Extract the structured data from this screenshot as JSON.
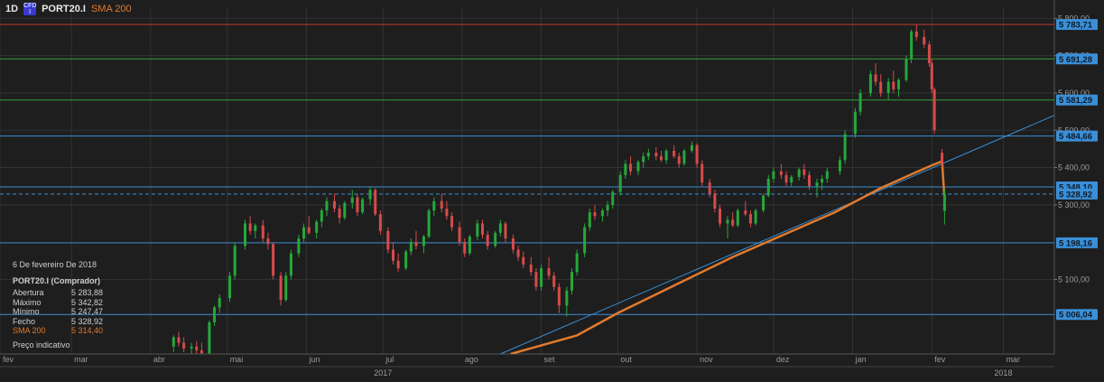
{
  "header": {
    "timeframe": "1D",
    "badge_top": "CFD",
    "badge_bottom": "I",
    "symbol": "PORT20.I",
    "indicator": "SMA 200"
  },
  "info": {
    "date": "6 De fevereiro De 2018",
    "title": "PORT20.I (Comprador)",
    "rows": [
      {
        "label": "Abertura",
        "value": "5 283,88"
      },
      {
        "label": "Máximo",
        "value": "5 342,82"
      },
      {
        "label": "Mínimo",
        "value": "5 247,47"
      },
      {
        "label": "Fecho",
        "value": "5 328,92"
      }
    ],
    "sma_label": "SMA 200",
    "sma_value": "5 314,40",
    "note": "Preço indicativo"
  },
  "chart_data": {
    "type": "candlestick",
    "y_range": [
      4900,
      5830
    ],
    "y_ticks": [
      {
        "v": 5800,
        "label": "5 800,00"
      },
      {
        "v": 5700,
        "label": "5 700,00"
      },
      {
        "v": 5600,
        "label": "5 600,00"
      },
      {
        "v": 5500,
        "label": "5 500,00"
      },
      {
        "v": 5400,
        "label": "5 400,00"
      },
      {
        "v": 5300,
        "label": "5 300,00"
      },
      {
        "v": 5100,
        "label": "5 100,00"
      }
    ],
    "x_range": [
      "2017-02-01",
      "2018-03-21"
    ],
    "x_months": [
      {
        "d": "2017-02-01",
        "label": "fev"
      },
      {
        "d": "2017-03-01",
        "label": "mar"
      },
      {
        "d": "2017-04-01",
        "label": "abr"
      },
      {
        "d": "2017-05-01",
        "label": "mai"
      },
      {
        "d": "2017-06-01",
        "label": "jun"
      },
      {
        "d": "2017-07-01",
        "label": "jul"
      },
      {
        "d": "2017-08-01",
        "label": "ago"
      },
      {
        "d": "2017-09-01",
        "label": "set"
      },
      {
        "d": "2017-10-01",
        "label": "out"
      },
      {
        "d": "2017-11-01",
        "label": "nov"
      },
      {
        "d": "2017-12-01",
        "label": "dez"
      },
      {
        "d": "2018-01-01",
        "label": "jan"
      },
      {
        "d": "2018-02-01",
        "label": "fev"
      },
      {
        "d": "2018-03-01",
        "label": "mar"
      }
    ],
    "x_years": [
      {
        "d": "2017-07-01",
        "label": "2017"
      },
      {
        "d": "2018-03-01",
        "label": "2018"
      }
    ],
    "levels": [
      {
        "v": 5783.71,
        "label": "5 783,71",
        "color": "#c0392b"
      },
      {
        "v": 5691.28,
        "label": "5 691,28",
        "color": "#2e9e3e"
      },
      {
        "v": 5581.29,
        "label": "5 581,29",
        "color": "#2e9e3e"
      },
      {
        "v": 5484.66,
        "label": "5 484,66",
        "color": "#3a8fd6"
      },
      {
        "v": 5348.1,
        "label": "5 348,10",
        "color": "#3a8fd6"
      },
      {
        "v": 5328.92,
        "label": "5 328,92",
        "color": "#3a8fd6",
        "dashed": true
      },
      {
        "v": 5198.16,
        "label": "5 198,16",
        "color": "#3a8fd6"
      },
      {
        "v": 5006.04,
        "label": "5 006,04",
        "color": "#3a8fd6"
      }
    ],
    "trendline": {
      "from": [
        "2017-08-16",
        4900
      ],
      "to": [
        "2018-03-21",
        5540
      ],
      "color": "#3a8fd6"
    },
    "sma200": {
      "color": "#e07a2e",
      "points": [
        [
          "2017-08-20",
          4900
        ],
        [
          "2017-09-15",
          4950
        ],
        [
          "2017-10-01",
          5010
        ],
        [
          "2017-10-25",
          5090
        ],
        [
          "2017-11-15",
          5160
        ],
        [
          "2017-12-05",
          5220
        ],
        [
          "2017-12-25",
          5280
        ],
        [
          "2018-01-12",
          5345
        ],
        [
          "2018-01-30",
          5400
        ],
        [
          "2018-02-05",
          5417
        ],
        [
          "2018-02-06",
          5314.4
        ]
      ]
    },
    "candles": [
      [
        "2017-04-10",
        4920,
        4950,
        4905,
        4945
      ],
      [
        "2017-04-12",
        4945,
        4960,
        4920,
        4930
      ],
      [
        "2017-04-14",
        4930,
        4945,
        4905,
        4915
      ],
      [
        "2017-04-17",
        4915,
        4930,
        4898,
        4920
      ],
      [
        "2017-04-19",
        4920,
        4935,
        4900,
        4910
      ],
      [
        "2017-04-21",
        4910,
        4930,
        4895,
        4902
      ],
      [
        "2017-04-24",
        4902,
        4990,
        4900,
        4985
      ],
      [
        "2017-04-26",
        4985,
        5030,
        4975,
        5025
      ],
      [
        "2017-04-28",
        5025,
        5060,
        5010,
        5050
      ],
      [
        "2017-05-02",
        5050,
        5120,
        5040,
        5110
      ],
      [
        "2017-05-04",
        5110,
        5200,
        5100,
        5190
      ],
      [
        "2017-05-08",
        5190,
        5260,
        5180,
        5250
      ],
      [
        "2017-05-10",
        5250,
        5270,
        5220,
        5230
      ],
      [
        "2017-05-12",
        5230,
        5250,
        5210,
        5245
      ],
      [
        "2017-05-15",
        5245,
        5260,
        5200,
        5210
      ],
      [
        "2017-05-17",
        5210,
        5225,
        5180,
        5195
      ],
      [
        "2017-05-19",
        5195,
        5200,
        5100,
        5110
      ],
      [
        "2017-05-22",
        5110,
        5120,
        5030,
        5045
      ],
      [
        "2017-05-24",
        5045,
        5120,
        5040,
        5110
      ],
      [
        "2017-05-26",
        5110,
        5180,
        5100,
        5170
      ],
      [
        "2017-05-29",
        5170,
        5220,
        5160,
        5210
      ],
      [
        "2017-05-31",
        5210,
        5250,
        5200,
        5240
      ],
      [
        "2017-06-02",
        5240,
        5270,
        5220,
        5225
      ],
      [
        "2017-06-05",
        5225,
        5260,
        5210,
        5255
      ],
      [
        "2017-06-07",
        5255,
        5290,
        5240,
        5285
      ],
      [
        "2017-06-09",
        5285,
        5320,
        5270,
        5310
      ],
      [
        "2017-06-12",
        5310,
        5330,
        5280,
        5290
      ],
      [
        "2017-06-14",
        5290,
        5300,
        5250,
        5265
      ],
      [
        "2017-06-16",
        5265,
        5310,
        5260,
        5305
      ],
      [
        "2017-06-19",
        5305,
        5340,
        5290,
        5320
      ],
      [
        "2017-06-21",
        5320,
        5330,
        5270,
        5280
      ],
      [
        "2017-06-23",
        5280,
        5320,
        5275,
        5315
      ],
      [
        "2017-06-26",
        5315,
        5350,
        5300,
        5340
      ],
      [
        "2017-06-28",
        5340,
        5345,
        5270,
        5275
      ],
      [
        "2017-06-30",
        5275,
        5285,
        5220,
        5230
      ],
      [
        "2017-07-03",
        5230,
        5240,
        5170,
        5180
      ],
      [
        "2017-07-05",
        5180,
        5200,
        5140,
        5150
      ],
      [
        "2017-07-07",
        5150,
        5170,
        5120,
        5130
      ],
      [
        "2017-07-10",
        5130,
        5180,
        5125,
        5175
      ],
      [
        "2017-07-12",
        5175,
        5210,
        5165,
        5200
      ],
      [
        "2017-07-14",
        5200,
        5230,
        5180,
        5190
      ],
      [
        "2017-07-17",
        5190,
        5220,
        5170,
        5215
      ],
      [
        "2017-07-19",
        5215,
        5290,
        5210,
        5285
      ],
      [
        "2017-07-21",
        5285,
        5320,
        5270,
        5310
      ],
      [
        "2017-07-24",
        5310,
        5330,
        5280,
        5290
      ],
      [
        "2017-07-26",
        5290,
        5310,
        5260,
        5270
      ],
      [
        "2017-07-28",
        5270,
        5280,
        5230,
        5240
      ],
      [
        "2017-07-31",
        5240,
        5255,
        5190,
        5200
      ],
      [
        "2017-08-02",
        5200,
        5210,
        5160,
        5170
      ],
      [
        "2017-08-04",
        5170,
        5220,
        5165,
        5215
      ],
      [
        "2017-08-07",
        5215,
        5260,
        5205,
        5250
      ],
      [
        "2017-08-09",
        5250,
        5260,
        5210,
        5220
      ],
      [
        "2017-08-11",
        5220,
        5230,
        5180,
        5190
      ],
      [
        "2017-08-14",
        5190,
        5230,
        5185,
        5225
      ],
      [
        "2017-08-16",
        5225,
        5260,
        5215,
        5250
      ],
      [
        "2017-08-18",
        5250,
        5255,
        5200,
        5210
      ],
      [
        "2017-08-21",
        5210,
        5220,
        5170,
        5180
      ],
      [
        "2017-08-23",
        5180,
        5190,
        5150,
        5160
      ],
      [
        "2017-08-25",
        5160,
        5175,
        5130,
        5140
      ],
      [
        "2017-08-28",
        5140,
        5160,
        5110,
        5120
      ],
      [
        "2017-08-30",
        5120,
        5130,
        5070,
        5080
      ],
      [
        "2017-09-01",
        5080,
        5140,
        5070,
        5130
      ],
      [
        "2017-09-04",
        5130,
        5160,
        5100,
        5110
      ],
      [
        "2017-09-06",
        5110,
        5120,
        5070,
        5080
      ],
      [
        "2017-09-08",
        5080,
        5090,
        5010,
        5030
      ],
      [
        "2017-09-11",
        5030,
        5080,
        5000,
        5070
      ],
      [
        "2017-09-13",
        5070,
        5130,
        5060,
        5120
      ],
      [
        "2017-09-15",
        5120,
        5180,
        5110,
        5170
      ],
      [
        "2017-09-18",
        5170,
        5250,
        5160,
        5240
      ],
      [
        "2017-09-20",
        5240,
        5290,
        5230,
        5280
      ],
      [
        "2017-09-22",
        5280,
        5300,
        5260,
        5270
      ],
      [
        "2017-09-25",
        5270,
        5290,
        5255,
        5285
      ],
      [
        "2017-09-27",
        5285,
        5310,
        5270,
        5300
      ],
      [
        "2017-09-29",
        5300,
        5340,
        5290,
        5335
      ],
      [
        "2017-10-02",
        5335,
        5390,
        5325,
        5380
      ],
      [
        "2017-10-04",
        5380,
        5420,
        5370,
        5410
      ],
      [
        "2017-10-06",
        5410,
        5430,
        5380,
        5390
      ],
      [
        "2017-10-09",
        5390,
        5420,
        5380,
        5415
      ],
      [
        "2017-10-11",
        5415,
        5440,
        5400,
        5430
      ],
      [
        "2017-10-13",
        5430,
        5450,
        5420,
        5440
      ],
      [
        "2017-10-16",
        5440,
        5455,
        5420,
        5430
      ],
      [
        "2017-10-18",
        5430,
        5445,
        5415,
        5420
      ],
      [
        "2017-10-20",
        5420,
        5450,
        5410,
        5445
      ],
      [
        "2017-10-23",
        5445,
        5460,
        5425,
        5430
      ],
      [
        "2017-10-25",
        5430,
        5440,
        5400,
        5410
      ],
      [
        "2017-10-27",
        5410,
        5450,
        5405,
        5445
      ],
      [
        "2017-10-30",
        5445,
        5470,
        5440,
        5460
      ],
      [
        "2017-11-01",
        5460,
        5465,
        5400,
        5410
      ],
      [
        "2017-11-03",
        5410,
        5420,
        5350,
        5360
      ],
      [
        "2017-11-06",
        5360,
        5370,
        5320,
        5330
      ],
      [
        "2017-11-08",
        5330,
        5340,
        5280,
        5290
      ],
      [
        "2017-11-10",
        5290,
        5300,
        5240,
        5250
      ],
      [
        "2017-11-13",
        5250,
        5270,
        5210,
        5260
      ],
      [
        "2017-11-15",
        5260,
        5280,
        5240,
        5245
      ],
      [
        "2017-11-17",
        5245,
        5290,
        5240,
        5285
      ],
      [
        "2017-11-20",
        5285,
        5310,
        5270,
        5275
      ],
      [
        "2017-11-22",
        5275,
        5285,
        5240,
        5250
      ],
      [
        "2017-11-24",
        5250,
        5290,
        5245,
        5285
      ],
      [
        "2017-11-27",
        5285,
        5330,
        5280,
        5325
      ],
      [
        "2017-11-29",
        5325,
        5380,
        5320,
        5370
      ],
      [
        "2017-12-01",
        5370,
        5400,
        5360,
        5390
      ],
      [
        "2017-12-04",
        5390,
        5410,
        5370,
        5380
      ],
      [
        "2017-12-06",
        5380,
        5390,
        5350,
        5360
      ],
      [
        "2017-12-08",
        5360,
        5380,
        5350,
        5375
      ],
      [
        "2017-12-11",
        5375,
        5400,
        5365,
        5395
      ],
      [
        "2017-12-13",
        5395,
        5410,
        5370,
        5380
      ],
      [
        "2017-12-15",
        5380,
        5390,
        5340,
        5350
      ],
      [
        "2017-12-18",
        5350,
        5370,
        5320,
        5360
      ],
      [
        "2017-12-20",
        5360,
        5380,
        5340,
        5370
      ],
      [
        "2017-12-22",
        5370,
        5400,
        5360,
        5390
      ],
      [
        "2017-12-27",
        5390,
        5430,
        5380,
        5420
      ],
      [
        "2017-12-29",
        5420,
        5500,
        5410,
        5490
      ],
      [
        "2018-01-02",
        5490,
        5560,
        5480,
        5550
      ],
      [
        "2018-01-04",
        5550,
        5610,
        5540,
        5600
      ],
      [
        "2018-01-08",
        5600,
        5660,
        5590,
        5650
      ],
      [
        "2018-01-10",
        5650,
        5680,
        5620,
        5630
      ],
      [
        "2018-01-12",
        5630,
        5650,
        5590,
        5600
      ],
      [
        "2018-01-15",
        5600,
        5640,
        5580,
        5630
      ],
      [
        "2018-01-17",
        5630,
        5660,
        5600,
        5610
      ],
      [
        "2018-01-19",
        5610,
        5640,
        5590,
        5635
      ],
      [
        "2018-01-22",
        5635,
        5700,
        5630,
        5690
      ],
      [
        "2018-01-24",
        5690,
        5770,
        5680,
        5765
      ],
      [
        "2018-01-26",
        5765,
        5783,
        5740,
        5750
      ],
      [
        "2018-01-29",
        5750,
        5770,
        5720,
        5730
      ],
      [
        "2018-01-31",
        5730,
        5740,
        5670,
        5680
      ],
      [
        "2018-02-01",
        5680,
        5690,
        5600,
        5610
      ],
      [
        "2018-02-02",
        5610,
        5615,
        5490,
        5500
      ],
      [
        "2018-02-05",
        5440,
        5450,
        5400,
        5410
      ],
      [
        "2018-02-06",
        5283.88,
        5342.82,
        5247.47,
        5328.92
      ]
    ]
  }
}
